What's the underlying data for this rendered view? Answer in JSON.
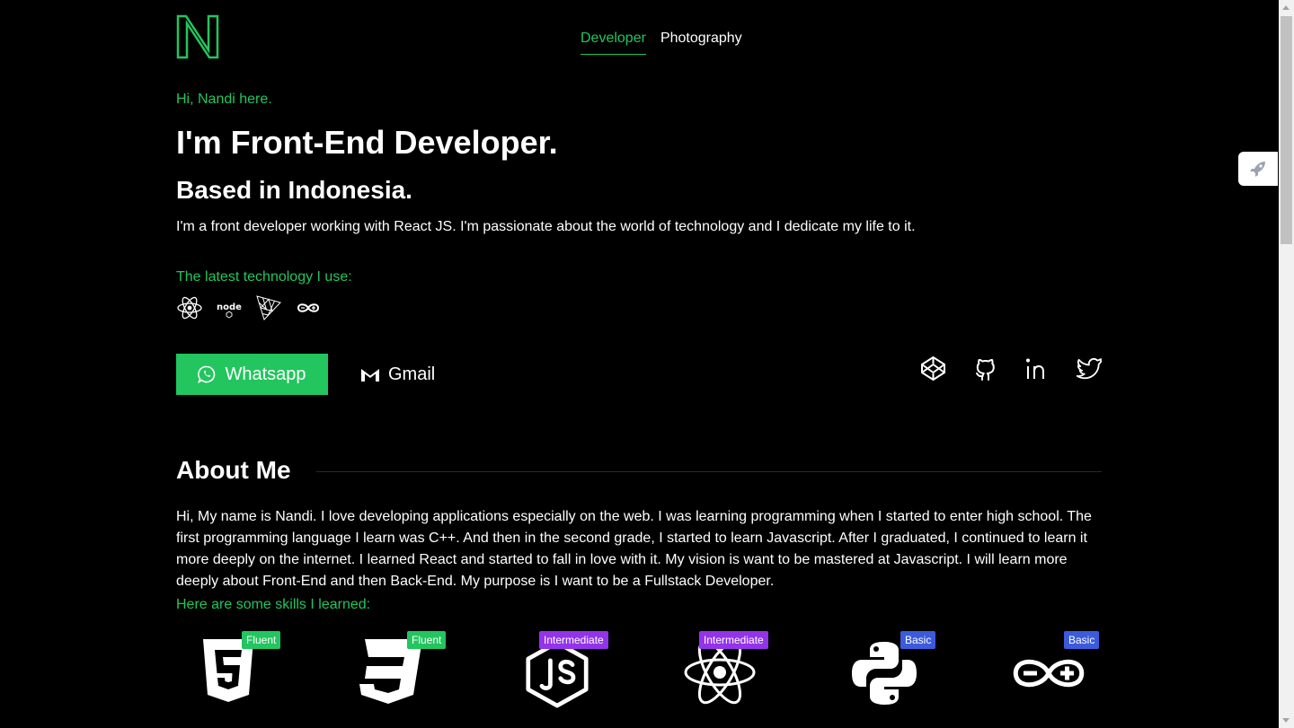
{
  "header": {
    "logo_letter": "N",
    "nav": [
      {
        "label": "Developer",
        "active": true
      },
      {
        "label": "Photography",
        "active": false
      }
    ]
  },
  "hero": {
    "greeting": "Hi, Nandi here.",
    "title": "I'm Front-End Developer.",
    "subtitle": "Based in Indonesia.",
    "intro": "I'm a front developer working with React JS. I'm passionate about the world of technology and I dedicate my life to it.",
    "tech_label": "The latest technology I use:",
    "tech_icons": [
      "react-icon",
      "nodejs-icon",
      "threejs-icon",
      "arduino-icon"
    ]
  },
  "contact": {
    "whatsapp_label": "Whatsapp",
    "gmail_label": "Gmail",
    "socials": [
      "codepen-icon",
      "github-icon",
      "linkedin-icon",
      "twitter-icon"
    ]
  },
  "about": {
    "heading": "About Me",
    "text": "Hi, My name is Nandi. I love developing applications especially on the web. I was learning programming when I started to enter high school. The first programming language I learn was C++. And then in the second grade, I started to learn Javascript. After I graduated, I continued to learn it more deeply on the internet. I learned React and started to fall in love with it. My vision is want to be mastered at Javascript. I will learn more deeply about Front-End and then Back-End. My purpose is I want to be a Fullstack Developer.",
    "skills_label": "Here are some skills I learned:",
    "skills": [
      {
        "icon": "html5-icon",
        "level": "Fluent",
        "color": "#22c55e"
      },
      {
        "icon": "css3-icon",
        "level": "Fluent",
        "color": "#22c55e"
      },
      {
        "icon": "nodejs-icon",
        "level": "Intermediate",
        "color": "#9333ea"
      },
      {
        "icon": "react-icon",
        "level": "Intermediate",
        "color": "#9333ea"
      },
      {
        "icon": "python-icon",
        "level": "Basic",
        "color": "#3b5bdb"
      },
      {
        "icon": "arduino-icon",
        "level": "Basic",
        "color": "#3b5bdb"
      }
    ]
  },
  "colors": {
    "accent": "#22c55e",
    "background": "#000000",
    "intermediate": "#9333ea",
    "basic": "#3b5bdb"
  }
}
